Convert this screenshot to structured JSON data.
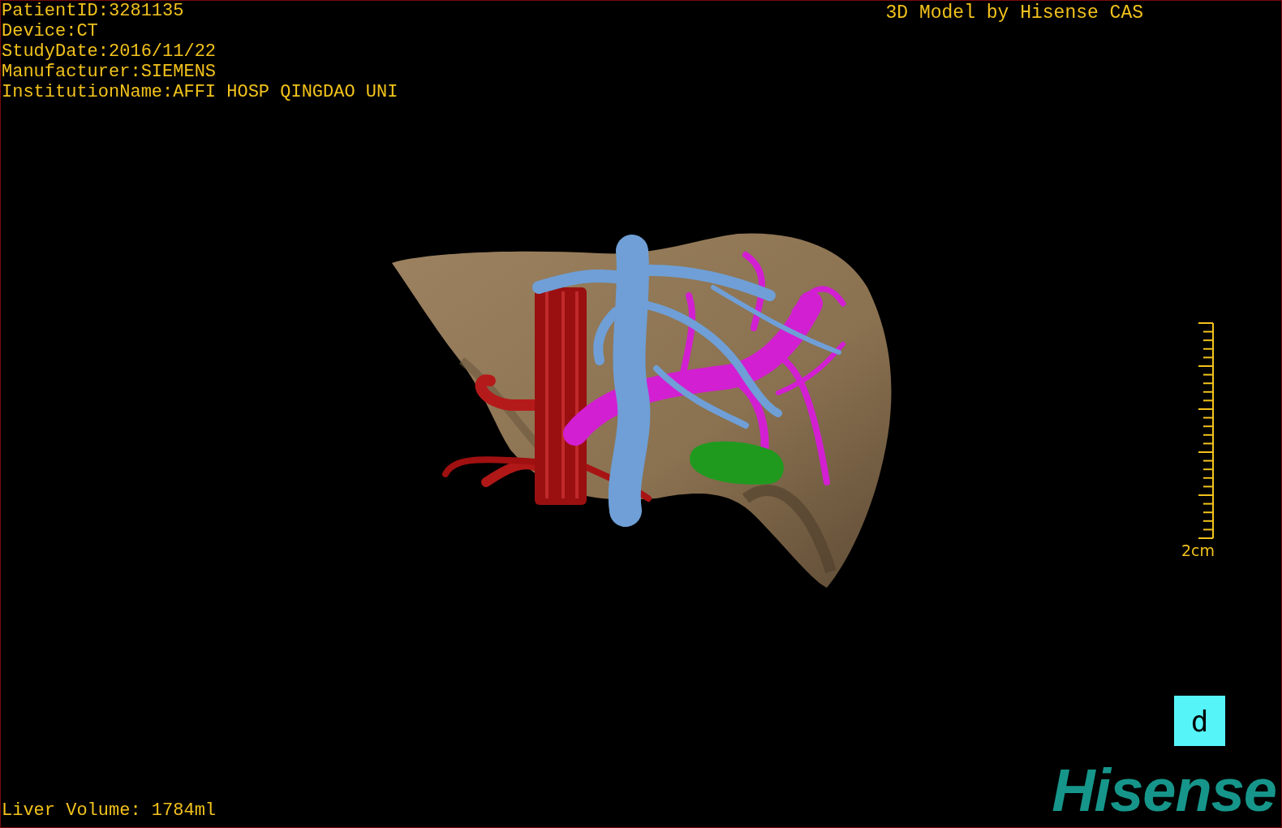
{
  "info_lines": [
    "PatientID:3281135",
    "Device:CT",
    "StudyDate:2016/11/22",
    "Manufacturer:SIEMENS",
    "InstitutionName:AFFI HOSP QINGDAO UNI"
  ],
  "model_title": "3D Model by Hisense CAS",
  "scale_bar": {
    "label": "2cm"
  },
  "liver_volume": "Liver Volume: 1784ml",
  "view_label": "d",
  "logo": "Hisense"
}
